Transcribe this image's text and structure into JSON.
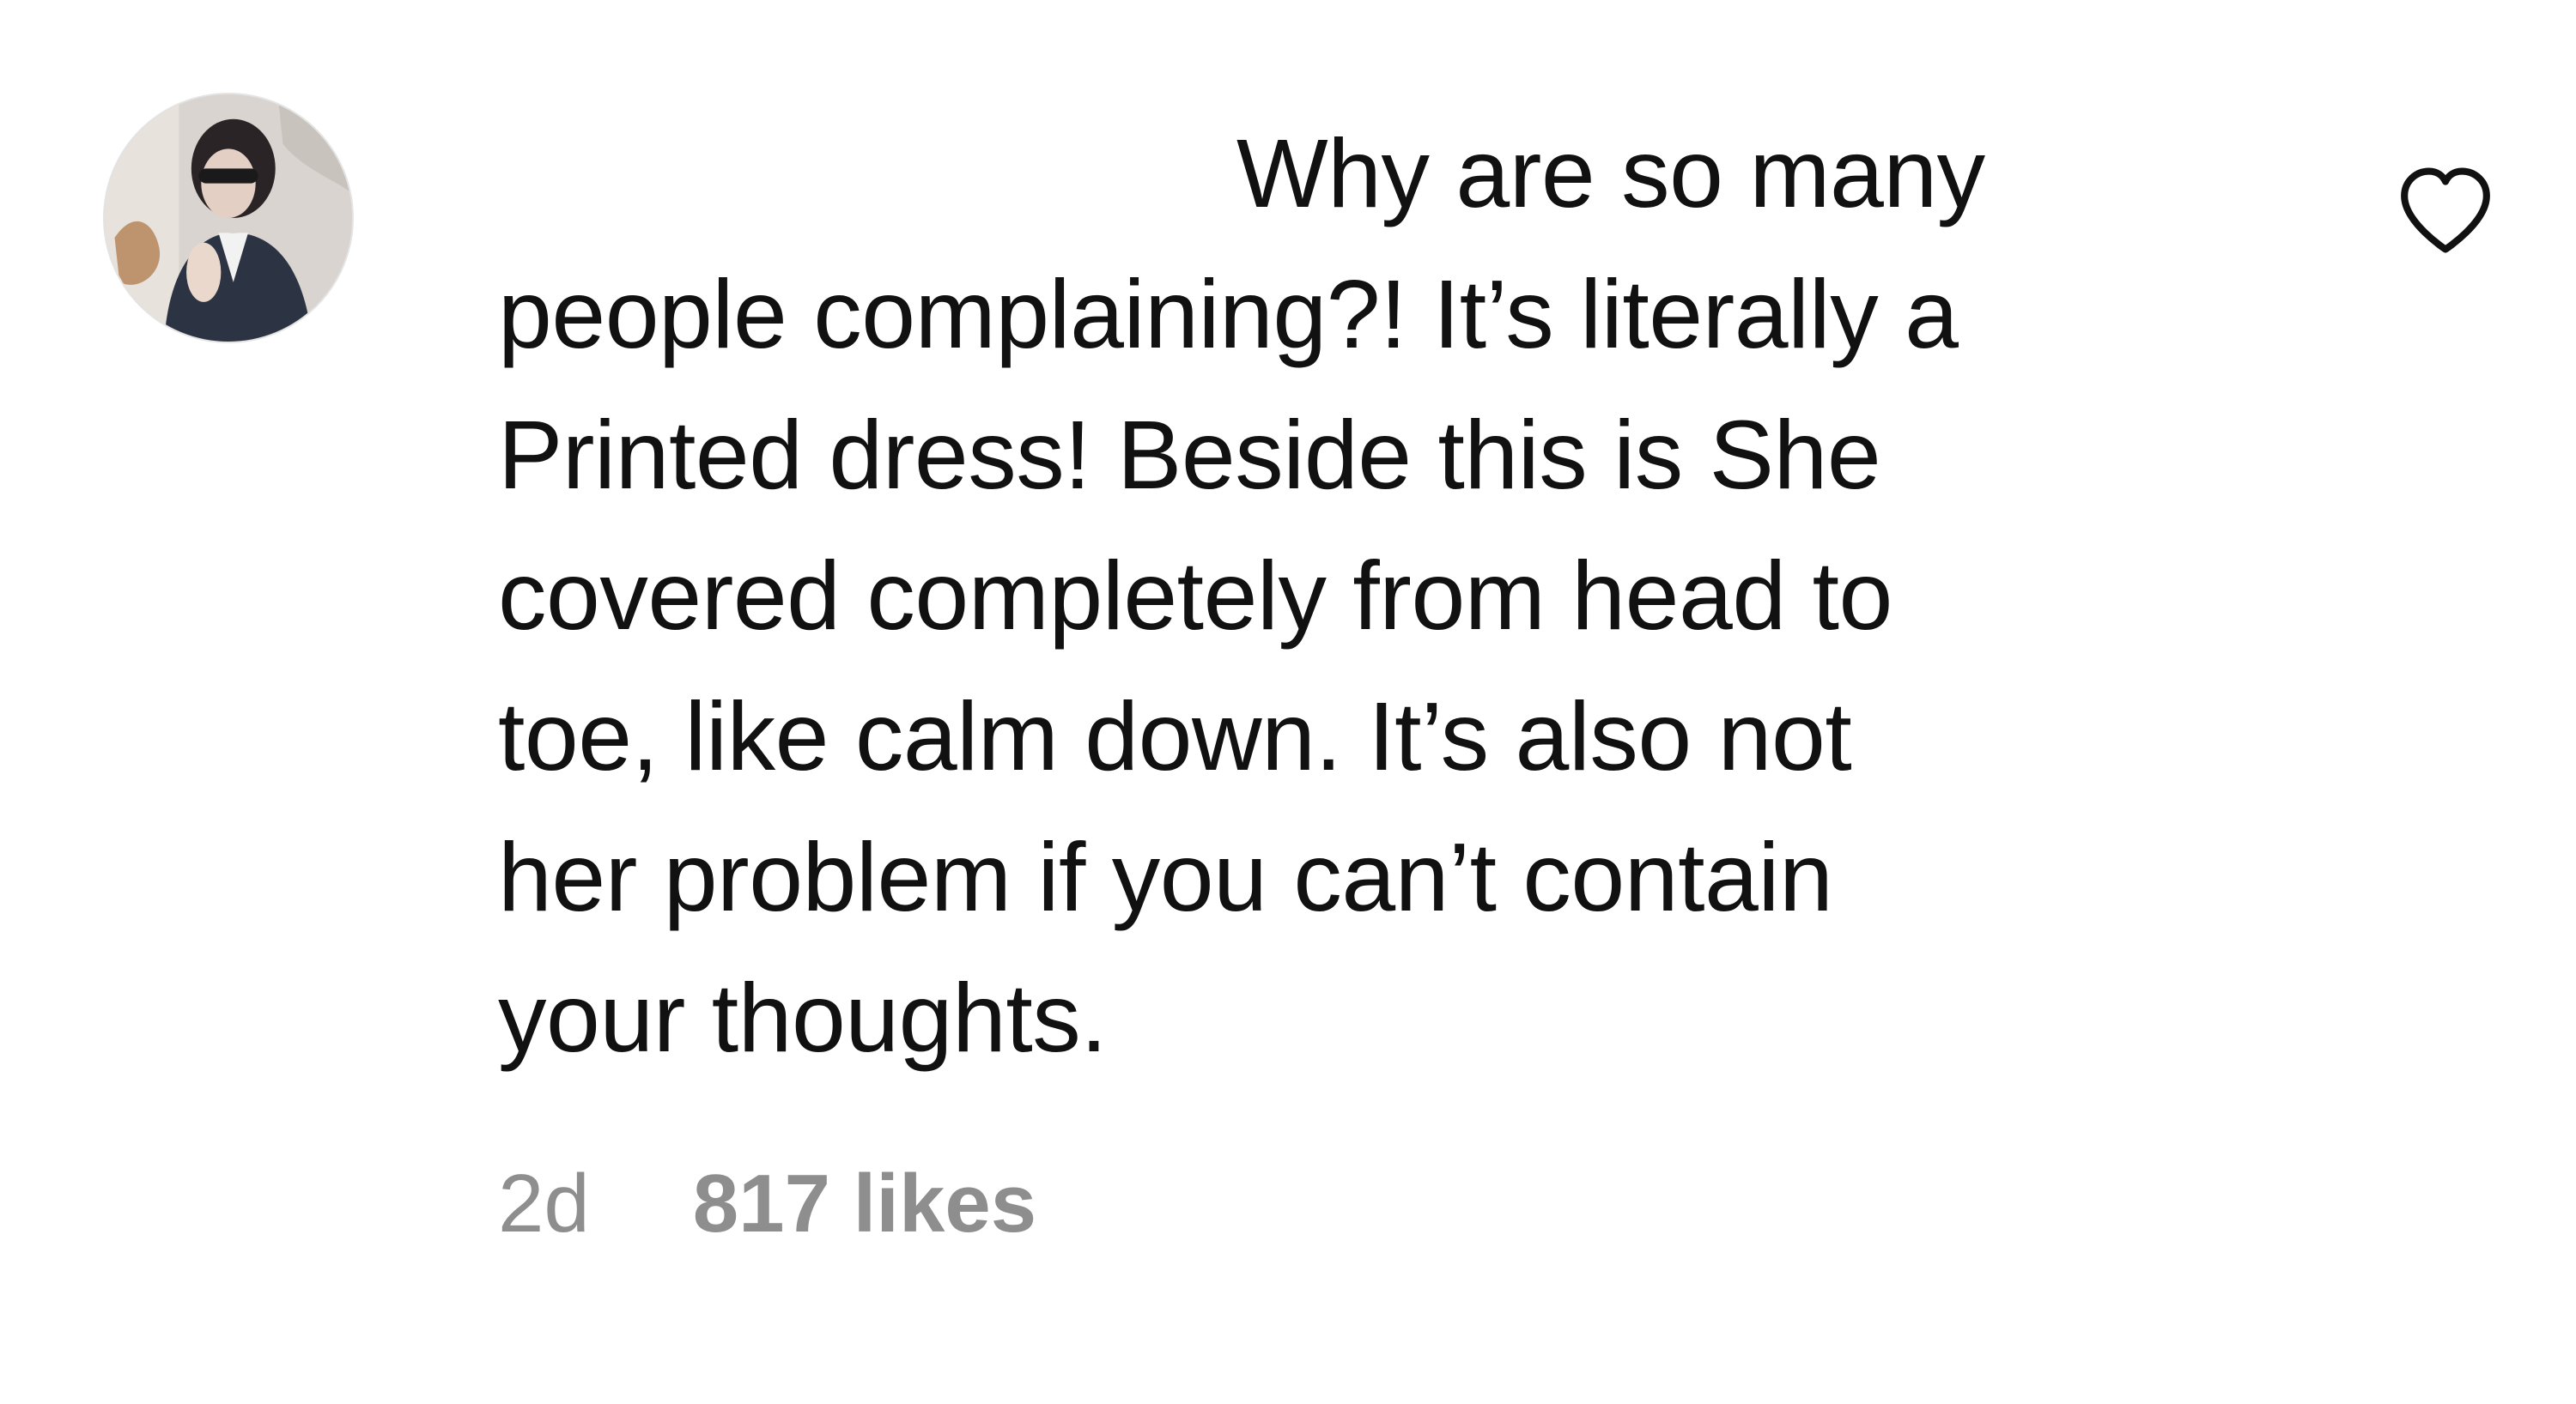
{
  "comment": {
    "avatar_icon": "profile-photo",
    "text_lines": [
      "Why are so many",
      "people complaining?! It’s literally a",
      "Printed dress! Beside this is She",
      "covered completely from head to",
      "toe, like calm down. It’s also not",
      "her problem if you can’t contain",
      "your thoughts."
    ],
    "timestamp": "2d",
    "likes_label": "817 likes",
    "like_icon": "heart-outline-icon"
  },
  "colors": {
    "text": "#111111",
    "meta": "#8e8e8e",
    "background": "#ffffff"
  }
}
